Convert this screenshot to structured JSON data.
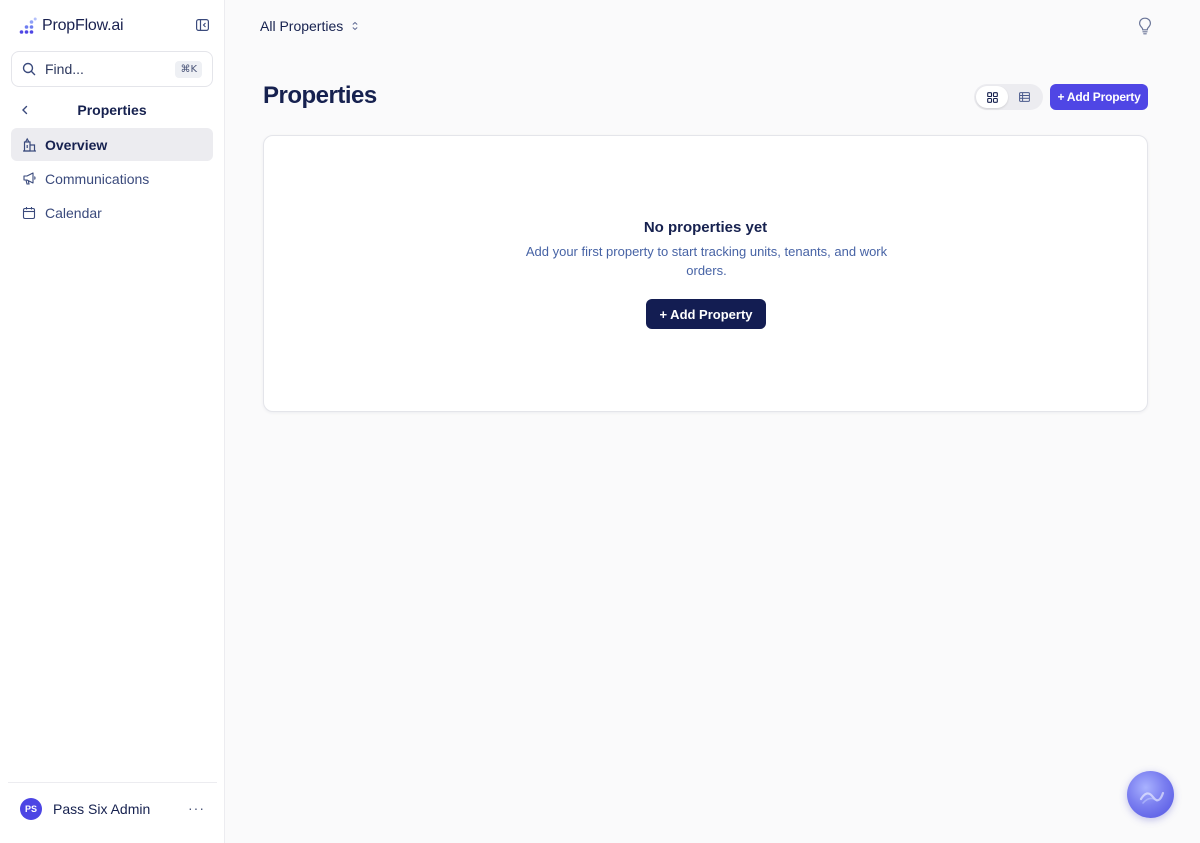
{
  "brand": {
    "name": "PropFlow.ai"
  },
  "search": {
    "placeholder": "Find...",
    "shortcut": "⌘K"
  },
  "section": {
    "title": "Properties"
  },
  "nav": {
    "items": [
      {
        "label": "Overview",
        "icon": "building-icon",
        "active": true
      },
      {
        "label": "Communications",
        "icon": "megaphone-icon",
        "active": false
      },
      {
        "label": "Calendar",
        "icon": "calendar-icon",
        "active": false
      }
    ]
  },
  "user": {
    "initials": "PS",
    "name": "Pass Six Admin",
    "more": "···"
  },
  "topbar": {
    "scope_label": "All Properties"
  },
  "main": {
    "title": "Properties",
    "add_button": "+ Add Property",
    "empty": {
      "title": "No properties yet",
      "description": "Add your first property to start tracking units, tenants, and work orders.",
      "button": "+ Add Property"
    }
  },
  "colors": {
    "accent": "#4f46e5",
    "navy": "#131d52",
    "text": "#16214f"
  }
}
